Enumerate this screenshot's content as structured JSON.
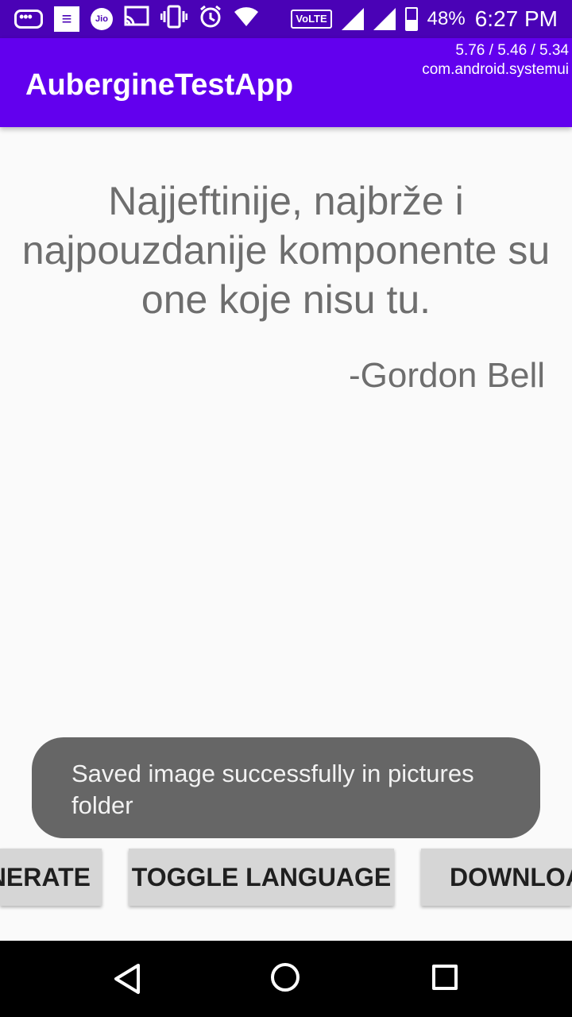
{
  "status_bar": {
    "battery": "48%",
    "time": "6:27 PM",
    "network": "VoLTE",
    "carrier_badge": "Jio",
    "icons_left": [
      "message-notification-icon",
      "media-notification-icon",
      "jio-icon",
      "cast-icon",
      "vibrate-icon",
      "alarm-icon",
      "wifi-icon"
    ],
    "icons_right": [
      "volte-icon",
      "signal-icon",
      "signal-icon",
      "battery-icon"
    ]
  },
  "app_bar": {
    "title": "AubergineTestApp",
    "overlay_line1": "5.76 / 5.46 / 5.34",
    "overlay_line2": "com.android.systemui"
  },
  "quote": {
    "text": "Najjeftinije, najbrže i najpouzdanije komponente su one koje nisu tu.",
    "author": "-Gordon Bell"
  },
  "toast": {
    "message": "Saved image successfully in pictures folder"
  },
  "buttons": {
    "generate": "NERATE",
    "toggle_language": "TOGGLE LANGUAGE",
    "download": "DOWNLOA"
  },
  "colors": {
    "status_bar": "#4a02b6",
    "app_bar": "#6200ee",
    "toast": "#666666",
    "button": "#d6d6d6"
  }
}
